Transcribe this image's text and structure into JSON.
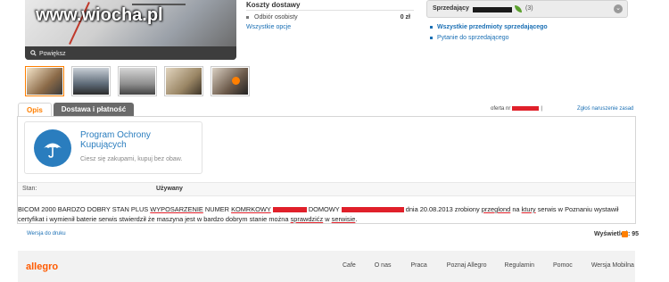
{
  "watermark": "www.wiocha.pl",
  "viewer": {
    "zoom_label": "Powiększ"
  },
  "shipping": {
    "title": "Koszty dostawy",
    "option": "Odbiór osobisty",
    "price": "0 zł",
    "all_options": "Wszystkie opcje"
  },
  "seller": {
    "label": "Sprzedający",
    "count": "(3)",
    "link_items": "Wszystkie przedmioty sprzedającego",
    "link_ask": "Pytanie do sprzedającego"
  },
  "tabs": {
    "desc": "Opis",
    "delivery": "Dostawa i płatność"
  },
  "offer": {
    "label": "oferta nr",
    "report": "Zgłoś naruszenie zasad"
  },
  "protection": {
    "title": "Program Ochrony Kupujących",
    "subtitle": "Ciesz się zakupami, kupuj bez obaw."
  },
  "params": {
    "label": "Stan:",
    "value": "Używany"
  },
  "description": {
    "p1": "BICOM 2000 BARDZO DOBRY STAN PLUS",
    "p2": "WYPOSARZENIE",
    "p3": "NUMER",
    "p4": "KOMRKOWY",
    "p5": "DOMOWY",
    "p6": "dnia 20.08.2013 zrobiony",
    "p7": "przeglond",
    "p8": "na",
    "p9": "ktury",
    "p10": "serwis w Poznaniu wystawił",
    "line2a": "certyfikat i wymienił baterie serwis stwierdził że maszyna jest w bardzo dobrym stanie można",
    "line2b": "sprawdzićz",
    "line2c": "w",
    "line2d": "serwisie",
    "line2e": "."
  },
  "print_link": "Wersja do druku",
  "views": "Wyświetleń: 95",
  "footer": {
    "logo": "allegro",
    "nav": [
      "Cafe",
      "O nas",
      "Praca",
      "Poznaj Allegro",
      "Regulamin",
      "Pomoc",
      "Wersja Mobilna"
    ]
  },
  "colors": {
    "accent": "#ff7f00",
    "link": "#1a6fb4",
    "brand": "#ff5a00",
    "redaction": "#e0202a"
  }
}
